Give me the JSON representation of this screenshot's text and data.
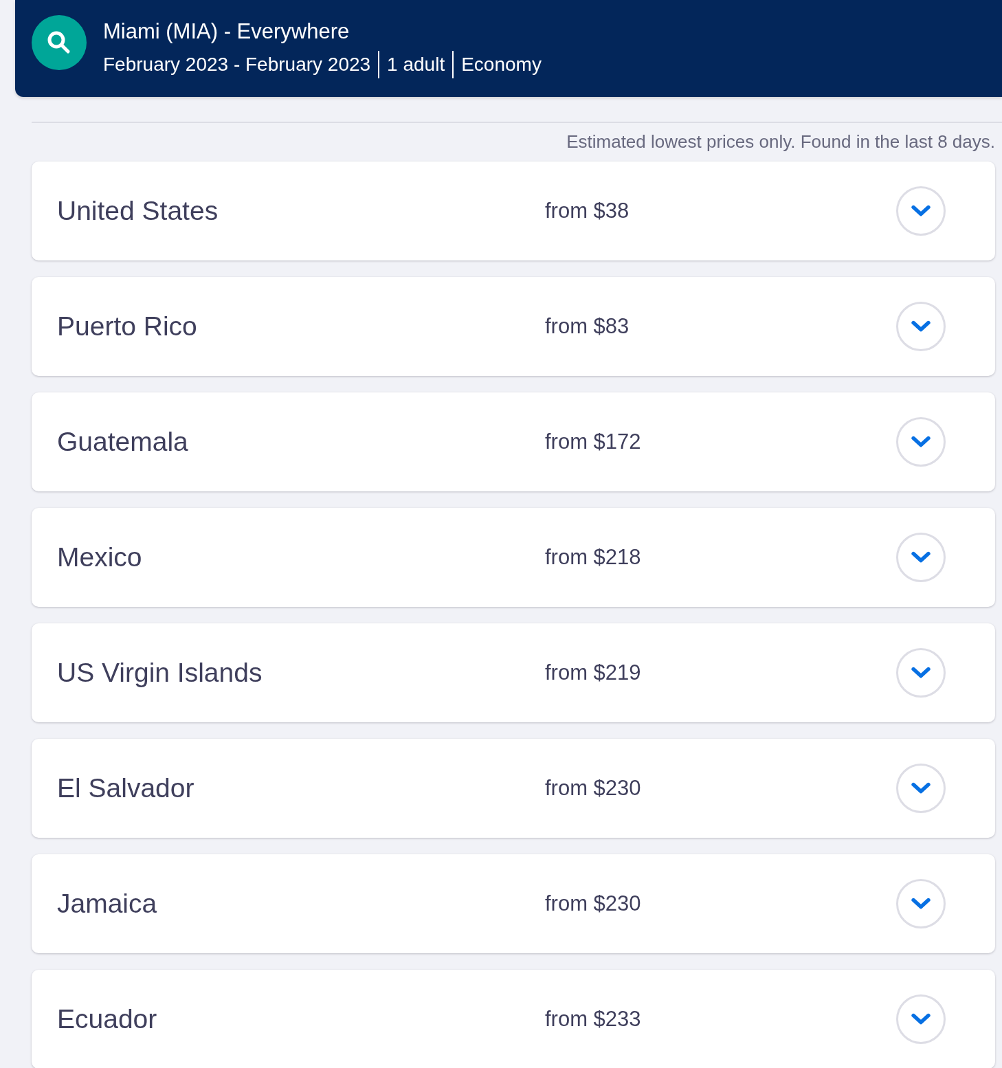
{
  "header": {
    "title": "Miami (MIA) - Everywhere",
    "details": [
      "February 2023 - February 2023",
      "1 adult",
      "Economy"
    ]
  },
  "note": "Estimated lowest prices only. Found in the last 8 days.",
  "destinations": [
    {
      "name": "United States",
      "price": "from $38",
      "expanded": false
    },
    {
      "name": "Puerto Rico",
      "price": "from $83",
      "expanded": false
    },
    {
      "name": "Guatemala",
      "price": "from $172",
      "expanded": false
    },
    {
      "name": "Mexico",
      "price": "from $218",
      "expanded": false
    },
    {
      "name": "US Virgin Islands",
      "price": "from $219",
      "expanded": false
    },
    {
      "name": "El Salvador",
      "price": "from $230",
      "expanded": false
    },
    {
      "name": "Jamaica",
      "price": "from $230",
      "expanded": false
    },
    {
      "name": "Ecuador",
      "price": "from $233",
      "expanded": false
    }
  ]
}
